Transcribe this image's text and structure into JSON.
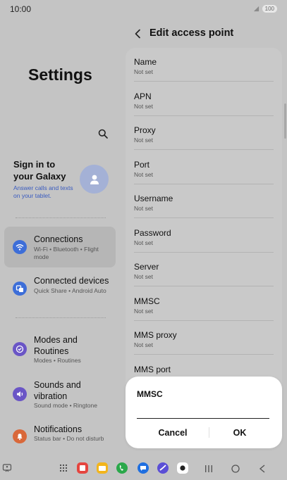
{
  "status_bar": {
    "time": "10:00",
    "battery": "100",
    "icons": [
      "signal-icon",
      "battery-icon"
    ]
  },
  "settings": {
    "title": "Settings",
    "search_icon": "search-icon",
    "account": {
      "title": "Sign in to your Galaxy",
      "subtitle": "Answer calls and texts on your tablet.",
      "avatar_icon": "person-icon"
    },
    "menu": [
      {
        "label": "Connections",
        "sub": "Wi-Fi • Bluetooth • Flight mode",
        "icon": "wifi-icon",
        "color": "#3d6ed8",
        "active": true
      },
      {
        "label": "Connected devices",
        "sub": "Quick Share • Android Auto",
        "icon": "connected-devices-icon",
        "color": "#3d6ed8",
        "active": false
      },
      {
        "label": "Modes and Routines",
        "sub": "Modes • Routines",
        "icon": "modes-routines-icon",
        "color": "#6a55c6",
        "active": false
      },
      {
        "label": "Sounds and vibration",
        "sub": "Sound mode • Ringtone",
        "icon": "sound-icon",
        "color": "#6a55c6",
        "active": false
      },
      {
        "label": "Notifications",
        "sub": "Status bar • Do not disturb",
        "icon": "bell-icon",
        "color": "#d9683a",
        "active": false
      }
    ]
  },
  "edit_access_point": {
    "title": "Edit access point",
    "fields": [
      {
        "title": "Name",
        "value": "Not set"
      },
      {
        "title": "APN",
        "value": "Not set"
      },
      {
        "title": "Proxy",
        "value": "Not set"
      },
      {
        "title": "Port",
        "value": "Not set"
      },
      {
        "title": "Username",
        "value": "Not set"
      },
      {
        "title": "Password",
        "value": "Not set"
      },
      {
        "title": "Server",
        "value": "Not set"
      },
      {
        "title": "MMSC",
        "value": "Not set"
      },
      {
        "title": "MMS proxy",
        "value": "Not set"
      },
      {
        "title": "MMS port",
        "value": ""
      }
    ]
  },
  "dialog": {
    "title": "MMSC",
    "input_value": "",
    "cancel_label": "Cancel",
    "ok_label": "OK"
  },
  "nav_bar": {
    "apps": [
      {
        "icon": "memo-app-icon",
        "color": "#e5453f"
      },
      {
        "icon": "files-app-icon",
        "color": "#f2b51c"
      },
      {
        "icon": "phone-app-icon",
        "color": "#2aa84a"
      },
      {
        "icon": "messages-app-icon",
        "color": "#1f6fe0"
      },
      {
        "icon": "internet-app-icon",
        "color": "#5b4fd6"
      },
      {
        "icon": "camera-app-icon",
        "color": "#ffffff"
      }
    ]
  }
}
